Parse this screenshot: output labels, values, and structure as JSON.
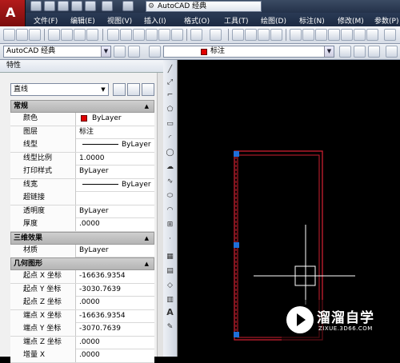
{
  "titlebar": {
    "workspace": "AutoCAD 经典"
  },
  "menu": {
    "items": [
      "文件(F)",
      "编辑(E)",
      "视图(V)",
      "插入(I)",
      "格式(O)",
      "工具(T)",
      "绘图(D)",
      "标注(N)",
      "修改(M)",
      "参数(P)"
    ]
  },
  "toolbar2": {
    "workspace": "AutoCAD 经典",
    "layer": "标注"
  },
  "panel": {
    "title": "特性",
    "object_type": "直线",
    "sections": [
      {
        "title": "常规",
        "rows": [
          {
            "key": "颜色",
            "value": "ByLayer",
            "kind": "color",
            "color": "#e00000"
          },
          {
            "key": "图层",
            "value": "标注"
          },
          {
            "key": "线型",
            "value": "ByLayer",
            "kind": "line"
          },
          {
            "key": "线型比例",
            "value": "1.0000"
          },
          {
            "key": "打印样式",
            "value": "ByLayer"
          },
          {
            "key": "线宽",
            "value": "ByLayer",
            "kind": "line"
          },
          {
            "key": "超链接",
            "value": ""
          },
          {
            "key": "透明度",
            "value": "ByLayer"
          },
          {
            "key": "厚度",
            "value": ".0000"
          }
        ]
      },
      {
        "title": "三维效果",
        "rows": [
          {
            "key": "材质",
            "value": "ByLayer"
          }
        ]
      },
      {
        "title": "几何图形",
        "rows": [
          {
            "key": "起点 X 坐标",
            "value": "-16636.9354"
          },
          {
            "key": "起点 Y 坐标",
            "value": "-3030.7639"
          },
          {
            "key": "起点 Z 坐标",
            "value": ".0000"
          },
          {
            "key": "端点 X 坐标",
            "value": "-16636.9354"
          },
          {
            "key": "端点 Y 坐标",
            "value": "-3070.7639"
          },
          {
            "key": "端点 Z 坐标",
            "value": ".0000"
          },
          {
            "key": "增量 X",
            "value": ".0000"
          }
        ]
      }
    ]
  },
  "watermark": {
    "brand": "溜溜自学",
    "url": "ZIXUE.3D66.COM"
  },
  "colors": {
    "accent": "#e00000",
    "canvas_bg": "#000000",
    "drawing_red": "#cc2030",
    "grip_blue": "#1e6fd9"
  }
}
